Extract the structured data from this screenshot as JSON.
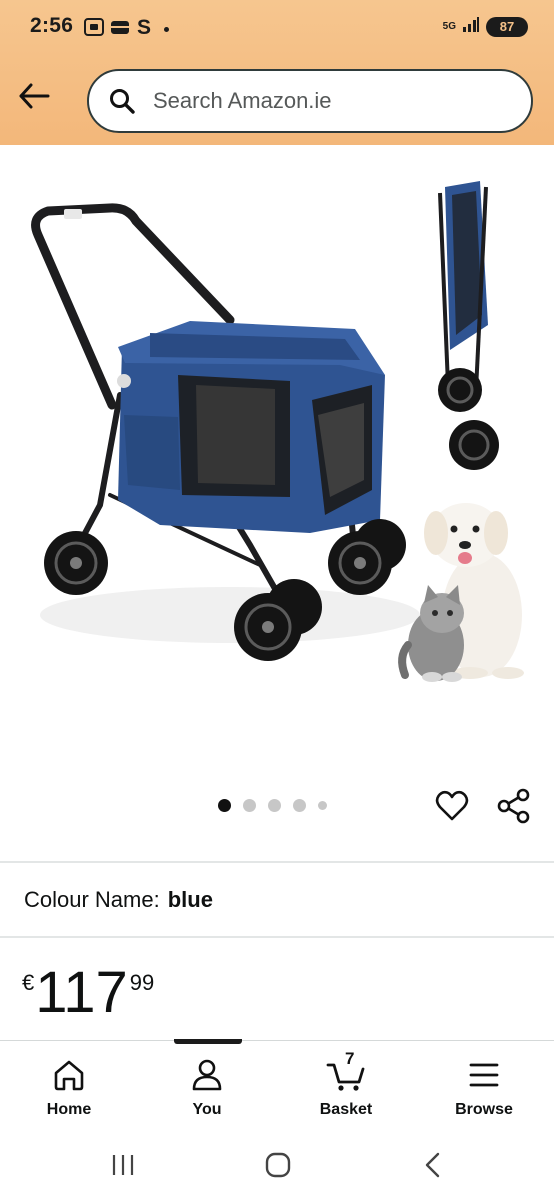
{
  "status_bar": {
    "time": "2:56",
    "left_glyph": "S",
    "network": "5G",
    "battery": "87"
  },
  "search": {
    "placeholder": "Search Amazon.ie"
  },
  "gallery": {
    "image_count": 5,
    "active_index": 0
  },
  "product": {
    "colour_label": "Colour Name:",
    "colour_value": "blue",
    "price_currency": "€",
    "price_whole": "117",
    "price_fraction": "99"
  },
  "bottom_nav": {
    "items": [
      {
        "label": "Home",
        "icon": "home-icon"
      },
      {
        "label": "You",
        "icon": "person-icon"
      },
      {
        "label": "Basket",
        "icon": "basket-icon",
        "count": "7"
      },
      {
        "label": "Browse",
        "icon": "menu-icon"
      }
    ]
  },
  "colors": {
    "header_bg": "#f3b77a",
    "text": "#0f1111",
    "product_blue": "#2f5492"
  }
}
